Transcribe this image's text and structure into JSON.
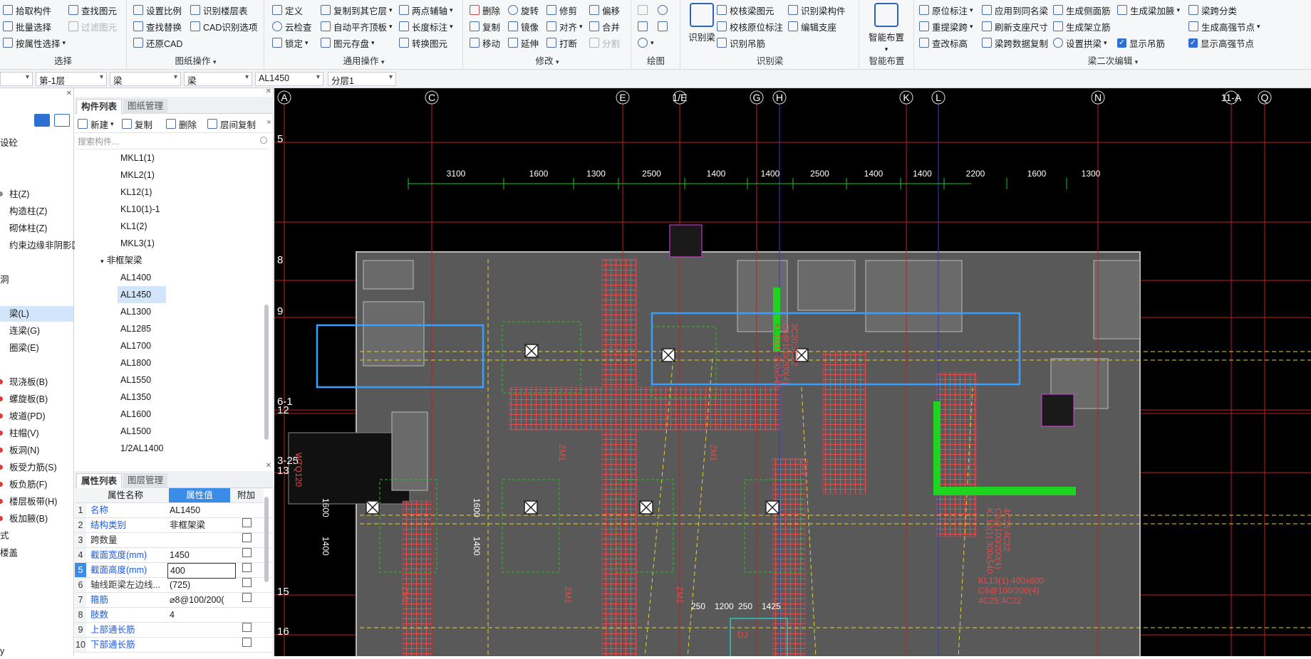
{
  "ribbon": {
    "groups": [
      {
        "title": "选择",
        "items": [
          "拾取构件",
          "批量选择",
          "按属性选择",
          "查找图元",
          "过滤图元"
        ]
      },
      {
        "title": "图纸操作",
        "items": [
          "设置比例",
          "识别楼层表",
          "查找替换",
          "CAD识别选项",
          "还原CAD"
        ]
      },
      {
        "title": "通用操作",
        "items": [
          "定义",
          "复制到其它层",
          "两点辅轴",
          "云检查",
          "自动平齐顶板",
          "长度标注",
          "锁定",
          "图元存盘",
          "转换图元"
        ]
      },
      {
        "title": "修改",
        "items": [
          "删除",
          "旋转",
          "修剪",
          "偏移",
          "复制",
          "镜像",
          "对齐",
          "合并",
          "移动",
          "延伸",
          "打断",
          "分割"
        ]
      },
      {
        "title": "绘图",
        "items": []
      },
      {
        "title": "识别梁",
        "items": [
          "识别梁",
          "校核梁图元",
          "识别梁构件",
          "校核原位标注",
          "编辑支座",
          "识别吊筋"
        ]
      },
      {
        "title": "智能布置",
        "items": [
          "智能布置"
        ]
      },
      {
        "title": "梁二次编辑",
        "items": [
          "原位标注",
          "应用到同名梁",
          "生成侧面筋",
          "生成梁加腋",
          "梁跨分类",
          "重提梁跨",
          "刷新支座尺寸",
          "生成架立筋",
          "生成高强节点",
          "查改标高",
          "梁跨数据复制",
          "设置拱梁",
          "显示吊筋",
          "显示高强节点"
        ]
      }
    ]
  },
  "selectors": [
    "",
    "第-1层",
    "梁",
    "梁",
    "AL1450",
    "分层1"
  ],
  "left_nav": [
    "设砼",
    "柱(Z)",
    "构造柱(Z)",
    "砌体柱(Z)",
    "约束边缘非阴影区",
    "洞",
    "梁(L)",
    "连梁(G)",
    "圈梁(E)",
    "现浇板(B)",
    "螺旋板(B)",
    "坡道(PD)",
    "柱帽(V)",
    "板洞(N)",
    "板受力筋(S)",
    "板负筋(F)",
    "楼层板带(H)",
    "板加腋(B)",
    "式",
    "楼盖",
    "y"
  ],
  "components": {
    "tabs": [
      "构件列表",
      "图纸管理"
    ],
    "actions": [
      "新建",
      "复制",
      "删除",
      "层间复制"
    ],
    "search_placeholder": "搜索构件...",
    "items": [
      "MKL1(1)",
      "MKL2(1)",
      "KL12(1)",
      "KL10(1)-1",
      "KL1(2)",
      "MKL3(1)"
    ],
    "group": "非框架梁",
    "group_items": [
      "AL1400",
      "AL1450",
      "AL1300",
      "AL1285",
      "AL1700",
      "AL1800",
      "AL1550",
      "AL1350",
      "AL1600",
      "AL1500",
      "1/2AL1400"
    ],
    "selected": "AL1450"
  },
  "properties": {
    "tabs": [
      "属性列表",
      "图层管理"
    ],
    "headers": [
      "属性名称",
      "属性值",
      "附加"
    ],
    "rows": [
      {
        "n": "1",
        "name": "名称",
        "value": "AL1450",
        "blue": true,
        "check": false
      },
      {
        "n": "2",
        "name": "结构类别",
        "value": "非框架梁",
        "blue": true,
        "check": true
      },
      {
        "n": "3",
        "name": "跨数量",
        "value": "",
        "blue": false,
        "check": true
      },
      {
        "n": "4",
        "name": "截面宽度(mm)",
        "value": "1450",
        "blue": true,
        "check": true
      },
      {
        "n": "5",
        "name": "截面高度(mm)",
        "value": "400",
        "blue": true,
        "check": true
      },
      {
        "n": "6",
        "name": "轴线距梁左边线...",
        "value": "(725)",
        "blue": false,
        "check": true
      },
      {
        "n": "7",
        "name": "箍筋",
        "value": "⌀8@100/200(",
        "blue": true,
        "check": true
      },
      {
        "n": "8",
        "name": "肢数",
        "value": "4",
        "blue": true,
        "check": false
      },
      {
        "n": "9",
        "name": "上部通长筋",
        "value": "",
        "blue": true,
        "check": true
      },
      {
        "n": "10",
        "name": "下部通长筋",
        "value": "",
        "blue": true,
        "check": true
      }
    ]
  },
  "cad": {
    "axes_top": [
      "A",
      "C",
      "E",
      "1/E",
      "G",
      "H",
      "K",
      "L",
      "N",
      "11-A",
      "Q"
    ],
    "axes_left": [
      "5",
      "8",
      "9",
      "6-1",
      "12",
      "3-25",
      "13",
      "15",
      "16"
    ],
    "dims_top": [
      "3100",
      "1600",
      "1300",
      "2500",
      "1400",
      "1400",
      "2500",
      "1400",
      "1400",
      "2200",
      "1600",
      "1300"
    ],
    "dims_bottom": [
      "250",
      "1200",
      "250",
      "1425"
    ],
    "side_dims": [
      "1600",
      "1400",
      "1600",
      "1400"
    ],
    "labels": [
      "ZM1",
      "ZM1",
      "ZM1",
      "ZM1",
      "ZM1",
      "ZM1",
      "KL13(1) 400x600",
      "C8@100/200(4)",
      "4C25;4C22",
      "KL12(1) 300x540",
      "C8@100/200(4)",
      "4C25;4C22",
      "KL11(1) 300x540",
      "C8@100/200(4)",
      "3C20;3C22",
      "WTQ120",
      "DJ"
    ]
  }
}
